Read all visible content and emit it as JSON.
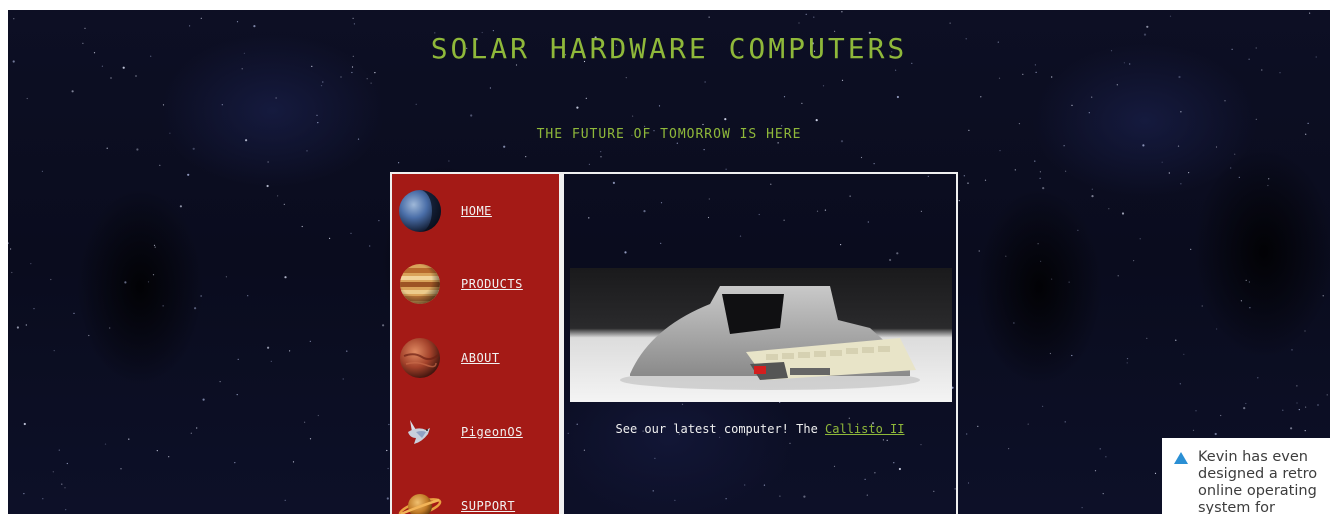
{
  "header": {
    "title": "SOLAR HARDWARE COMPUTERS",
    "tagline": "THE FUTURE OF TOMORROW IS HERE"
  },
  "nav": {
    "items": [
      {
        "label": "HOME",
        "icon": "neptune-planet-icon"
      },
      {
        "label": "PRODUCTS",
        "icon": "jupiter-planet-icon"
      },
      {
        "label": "ABOUT",
        "icon": "mars-planet-icon"
      },
      {
        "label": "PigeonOS",
        "icon": "pigeon-icon"
      },
      {
        "label": "SUPPORT",
        "icon": "saturn-planet-icon"
      }
    ]
  },
  "content": {
    "caption_text": "See our latest computer! The ",
    "caption_link": "Callisto II",
    "image": "callisto-ii-computer-photo"
  },
  "annotation": {
    "text": "Kevin has even designed a retro online operating system for Callisto",
    "icon": "triangle-up-icon"
  },
  "colors": {
    "accent_green": "#8fb83a",
    "nav_red": "#a41a16",
    "frame_white": "#f0f0f0",
    "note_triangle": "#2a8fd4"
  }
}
